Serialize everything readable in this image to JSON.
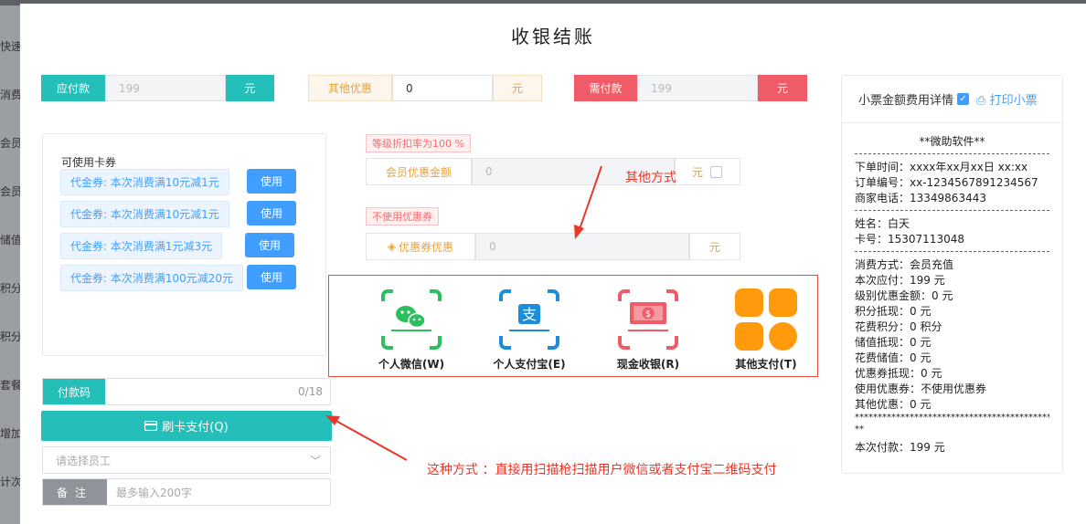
{
  "sidebar": [
    "快速",
    "消费",
    "会员",
    "会员",
    "储值",
    "积分",
    "积分",
    "套餐",
    "增加",
    "计次"
  ],
  "title": "收银结账",
  "top": {
    "payable": {
      "label": "应付款",
      "value": "199",
      "unit": "元"
    },
    "other_discount": {
      "label": "其他优惠",
      "value": "0",
      "unit": "元"
    },
    "due": {
      "label": "需付款",
      "value": "199",
      "unit": "元"
    }
  },
  "coupons": {
    "title": "可使用卡券",
    "use_label": "使用",
    "items": [
      "代金券: 本次消费满10元减1元",
      "代金券: 本次消费满10元减1元",
      "代金券: 本次消费满1元减3元",
      "代金券: 本次消费满100元减20元"
    ]
  },
  "member": {
    "level_tag": "等级折扣率为100 %",
    "discount_label": "会员优惠金额",
    "discount_value": "0",
    "unit": "元",
    "coupon_tag": "不使用优惠券",
    "coupon_label": "优惠券优惠",
    "coupon_value": "0"
  },
  "payments": [
    "个人微信(W)",
    "个人支付宝(E)",
    "现金收银(R)",
    "其他支付(T)"
  ],
  "code": {
    "label": "付款码",
    "count": "0/18"
  },
  "swipe_label": "刷卡支付(Q)",
  "staff_placeholder": "请选择员工",
  "note": {
    "label": "备注",
    "placeholder": "最多输入200字"
  },
  "annotations": {
    "other": "其他方式",
    "scan": "这种方式 ：直接用扫描枪扫描用户微信或者支付宝二维码支付"
  },
  "receipt": {
    "header_label": "小票金额费用详情",
    "print_label": "打印小票",
    "shop": "**微助软件**",
    "lines1": [
      "下单时间：xxxx年xx月xx日 xx:xx",
      "订单编号：xx-1234567891234567",
      "商家电话：13349863443"
    ],
    "lines2": [
      "姓名：白天",
      "卡号：15307113048"
    ],
    "lines3": [
      "消费方式：会员充值",
      "本次应付：199 元",
      "级别优惠金额：0 元",
      "积分抵现：0 元",
      "花费积分：0 积分",
      "储值抵现：0 元",
      "花费储值：0 元",
      "优惠券抵现：0 元",
      "使用优惠券：不使用优惠券",
      "其他优惠：0 元"
    ],
    "stars": "********************************************",
    "stars2": "**",
    "total": "本次付款：199 元"
  },
  "colors": {
    "teal": "#25bfb9",
    "red": "#ef5b67",
    "blue": "#409eff",
    "annotation": "#e8382b"
  }
}
